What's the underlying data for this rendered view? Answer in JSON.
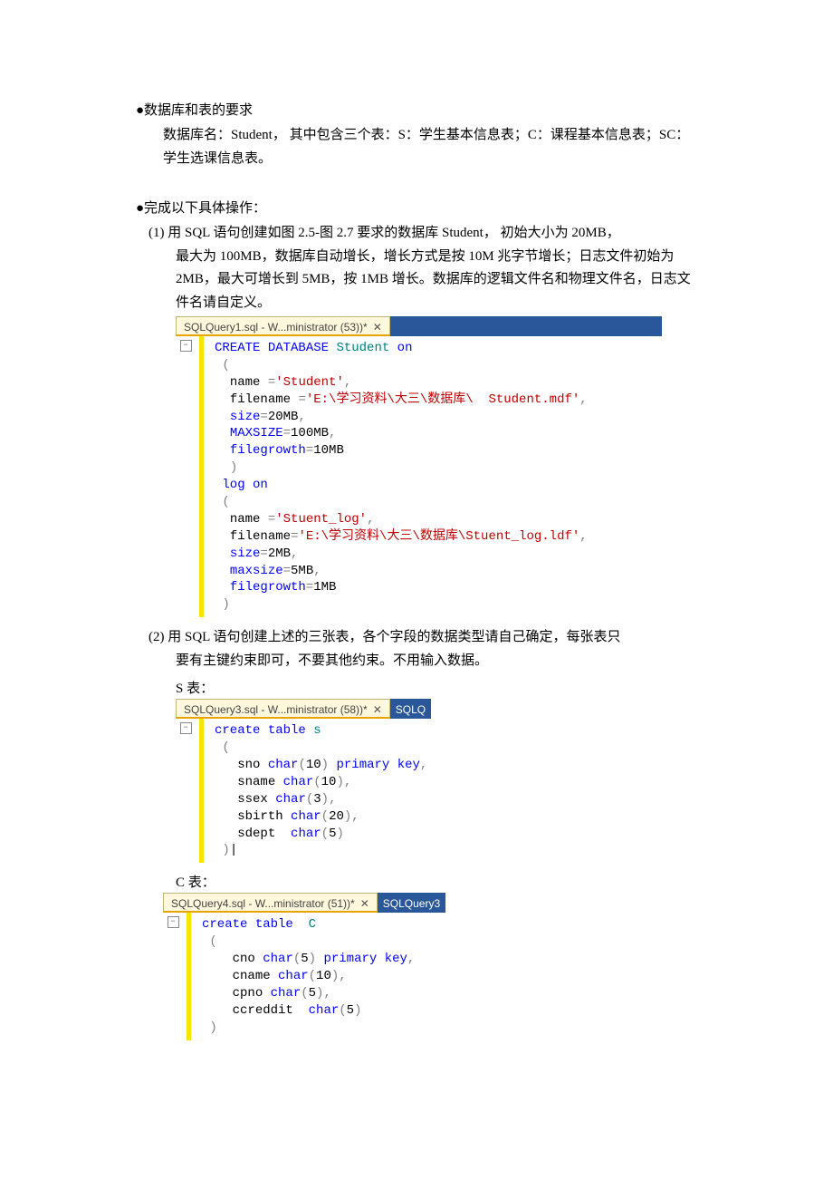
{
  "bullets": {
    "b1_title": "●数据库和表的要求",
    "b1_body": "数据库名：Student， 其中包含三个表：S：学生基本信息表；C：课程基本信息表；SC：学生选课信息表。",
    "b2_title": "●完成以下具体操作：",
    "item1_first": "(1) 用 SQL 语句创建如图 2.5-图 2.7 要求的数据库 Student， 初始大小为 20MB，",
    "item1_rest": "最大为 100MB，数据库自动增长，增长方式是按 10M 兆字节增长；日志文件初始为 2MB，最大可增长到 5MB，按 1MB 增长。数据库的逻辑文件名和物理文件名，日志文件名请自定义。",
    "item1_tab": "SQLQuery1.sql - W...ministrator (53))*",
    "item2_first": "(2) 用 SQL 语句创建上述的三张表，各个字段的数据类型请自己确定，每张表只",
    "item2_rest": "要有主键约束即可，不要其他约束。不用输入数据。",
    "s_label": "S 表：",
    "s_tab": "SQLQuery3.sql - W...ministrator (58))*",
    "s_tab2": "SQLQ",
    "c_label": "C 表：",
    "c_tab": "SQLQuery4.sql - W...ministrator (51))*",
    "c_tab2": "SQLQuery3",
    "close_x": "✕"
  },
  "code1": {
    "l01a": "CREATE",
    "l01b": "DATABASE",
    "l01c": "Student",
    "l01d": "on",
    "l02": "(",
    "l03a": "name",
    "l03b": "=",
    "l03c": "'Student'",
    "l03d": ",",
    "l04a": "filename",
    "l04b": "=",
    "l04c": "'E:\\学习资料\\大三\\数据库\\  Student.mdf'",
    "l04d": ",",
    "l05a": "size",
    "l05b": "=",
    "l05c": "20MB",
    "l05d": ",",
    "l06a": "MAXSIZE",
    "l06b": "=",
    "l06c": "100MB",
    "l06d": ",",
    "l07a": "filegrowth",
    "l07b": "=",
    "l07c": "10MB",
    "l08": ")",
    "l09a": "log",
    "l09b": "on",
    "l10": "(",
    "l11a": "name",
    "l11b": "=",
    "l11c": "'Stuent_log'",
    "l11d": ",",
    "l12a": "filename",
    "l12b": "=",
    "l12c": "'E:\\学习资料\\大三\\数据库\\Stuent_log.ldf'",
    "l12d": ",",
    "l13a": "size",
    "l13b": "=",
    "l13c": "2MB",
    "l13d": ",",
    "l14a": "maxsize",
    "l14b": "=",
    "l14c": "5MB",
    "l14d": ",",
    "l15a": "filegrowth",
    "l15b": "=",
    "l15c": "1MB",
    "l16": ")"
  },
  "code2": {
    "l1a": "create",
    "l1b": "table",
    "l1c": "s",
    "l2": "(",
    "l3a": "sno",
    "l3b": "char",
    "l3c": "(",
    "l3d": "10",
    "l3e": ")",
    "l3f": "primary",
    "l3g": "key",
    "l3h": ",",
    "l4a": "sname",
    "l4b": "char",
    "l4c": "(",
    "l4d": "10",
    "l4e": ")",
    "l4f": ",",
    "l5a": "ssex",
    "l5b": "char",
    "l5c": "(",
    "l5d": "3",
    "l5e": ")",
    "l5f": ",",
    "l6a": "sbirth",
    "l6b": "char",
    "l6c": "(",
    "l6d": "20",
    "l6e": ")",
    "l6f": ",",
    "l7a": "sdept",
    "l7b": "char",
    "l7c": "(",
    "l7d": "5",
    "l7e": ")",
    "l8a": ")",
    "l8b": "|"
  },
  "code3": {
    "l1a": "create",
    "l1b": "table",
    "l1c": "C",
    "l2": "(",
    "l3a": "cno",
    "l3b": "char",
    "l3c": "(",
    "l3d": "5",
    "l3e": ")",
    "l3f": "primary",
    "l3g": "key",
    "l3h": ",",
    "l4a": "cname",
    "l4b": "char",
    "l4c": "(",
    "l4d": "10",
    "l4e": ")",
    "l4f": ",",
    "l5a": "cpno",
    "l5b": "char",
    "l5c": "(",
    "l5d": "5",
    "l5e": ")",
    "l5f": ",",
    "l6a": "ccreddit",
    "l6b": "char",
    "l6c": "(",
    "l6d": "5",
    "l6e": ")",
    "l7": ")"
  }
}
